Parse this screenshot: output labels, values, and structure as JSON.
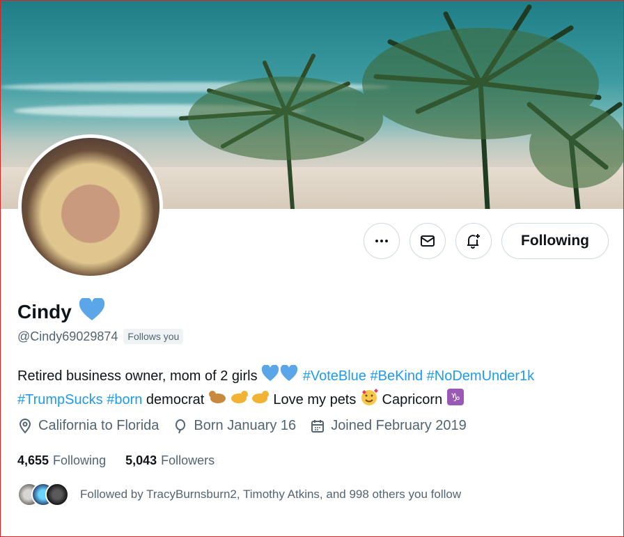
{
  "profile": {
    "name": "Cindy",
    "handle": "@Cindy69029874",
    "follows_you_label": "Follows you",
    "bio_text_1": "Retired business owner, mom of 2 girls",
    "hashtags_line1": [
      "#VoteBlue",
      "#BeKind",
      "#NoDemUnder1k"
    ],
    "hashtags_line2": [
      "#TrumpSucks",
      "#born"
    ],
    "bio_text_2": "democrat",
    "bio_text_3": "Love my pets",
    "bio_text_4": "Capricorn",
    "location": "California to Florida",
    "birthday": "Born January 16",
    "joined": "Joined February 2019"
  },
  "actions": {
    "following_label": "Following"
  },
  "counts": {
    "following_count": "4,655",
    "following_label": "Following",
    "followers_count": "5,043",
    "followers_label": "Followers"
  },
  "followed_by": {
    "text": "Followed by TracyBurnsburn2, Timothy Atkins, and 998 others you follow"
  },
  "icons": [
    "more-icon",
    "mail-icon",
    "notification-bell-icon",
    "blue-heart-icon",
    "location-icon",
    "balloon-icon",
    "calendar-icon"
  ],
  "colors": {
    "accent": "#1d9bf0",
    "secondary_text": "#536471",
    "heart": "#5aa6e8"
  }
}
